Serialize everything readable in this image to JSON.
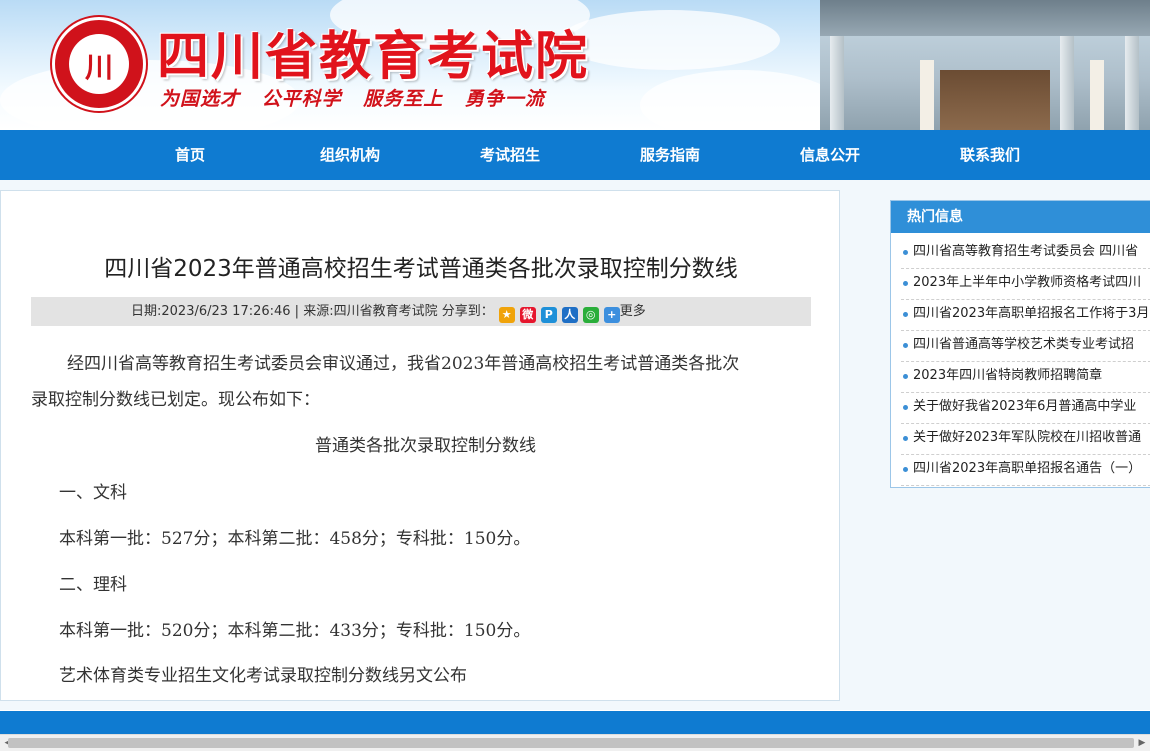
{
  "header": {
    "site_title": "四川省教育考试院",
    "slogan": "为国选才  公平科学  服务至上  勇争一流",
    "logo_glyph": "川"
  },
  "nav": {
    "items": [
      "首页",
      "组织机构",
      "考试招生",
      "服务指南",
      "信息公开",
      "联系我们"
    ]
  },
  "article": {
    "title": "四川省2023年普通高校招生考试普通类各批次录取控制分数线",
    "meta": "日期:2023/6/23 17:26:46 | 来源:四川省教育考试院   分享到：",
    "share_more": "更多",
    "intro_line1": "经四川省高等教育招生考试委员会审议通过，我省2023年普通高校招生考试普通类各批次",
    "intro_line2": "录取控制分数线已划定。现公布如下：",
    "subtitle": "普通类各批次录取控制分数线",
    "section1": "一、文科",
    "section1_text": "本科第一批：527分；本科第二批：458分；专科批：150分。",
    "section2": "二、理科",
    "section2_text": "本科第一批：520分；本科第二批：433分；专科批：150分。",
    "note": "艺术体育类专业招生文化考试录取控制分数线另文公布"
  },
  "sidebar": {
    "title": "热门信息",
    "items": [
      "四川省高等教育招生考试委员会 四川省",
      "2023年上半年中小学教师资格考试四川",
      "四川省2023年高职单招报名工作将于3月",
      "四川省普通高等学校艺术类专业考试招",
      "2023年四川省特岗教师招聘简章",
      "关于做好我省2023年6月普通高中学业",
      "关于做好2023年军队院校在川招收普通",
      "四川省2023年高职单招报名通告（一）"
    ]
  },
  "colors": {
    "nav_blue": "#0f7bd1",
    "title_red": "#e1131c",
    "sidebar_head": "#2f8fd8"
  }
}
